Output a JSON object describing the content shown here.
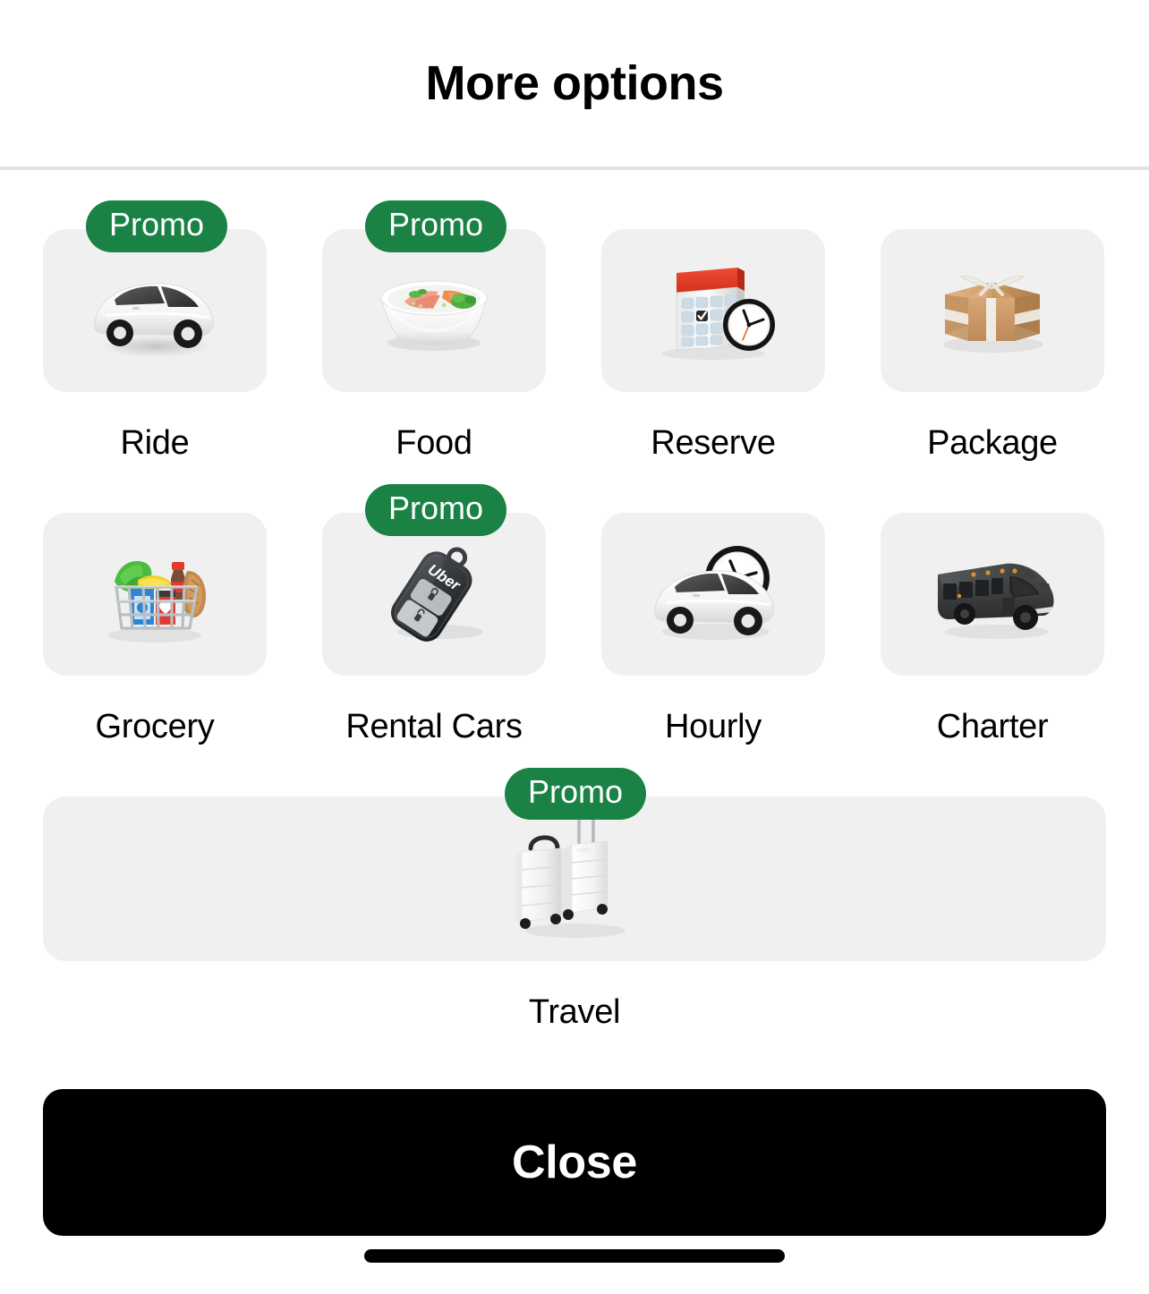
{
  "header": {
    "title": "More options"
  },
  "badge": {
    "promo_label": "Promo",
    "promo_bg_color": "#1a8245",
    "promo_text_color": "#ffffff"
  },
  "theme": {
    "tile_bg_color": "#f0f0f0",
    "page_bg_color": "#ffffff",
    "text_color": "#000000",
    "divider_color": "#e3e3e3",
    "button_bg_color": "#000000",
    "button_text_color": "#ffffff"
  },
  "options": [
    {
      "id": "ride",
      "label": "Ride",
      "icon": "white-car-icon",
      "has_promo": true
    },
    {
      "id": "food",
      "label": "Food",
      "icon": "noodle-bowl-icon",
      "has_promo": true
    },
    {
      "id": "reserve",
      "label": "Reserve",
      "icon": "calendar-clock-icon",
      "has_promo": false
    },
    {
      "id": "package",
      "label": "Package",
      "icon": "cardboard-box-icon",
      "has_promo": false
    },
    {
      "id": "grocery",
      "label": "Grocery",
      "icon": "grocery-basket-icon",
      "has_promo": false
    },
    {
      "id": "rental-cars",
      "label": "Rental Cars",
      "icon": "car-key-fob-icon",
      "has_promo": true
    },
    {
      "id": "hourly",
      "label": "Hourly",
      "icon": "car-with-clock-icon",
      "has_promo": false
    },
    {
      "id": "charter",
      "label": "Charter",
      "icon": "shuttle-bus-icon",
      "has_promo": false
    },
    {
      "id": "travel",
      "label": "Travel",
      "icon": "suitcases-icon",
      "has_promo": true
    }
  ],
  "footer": {
    "close_label": "Close"
  }
}
